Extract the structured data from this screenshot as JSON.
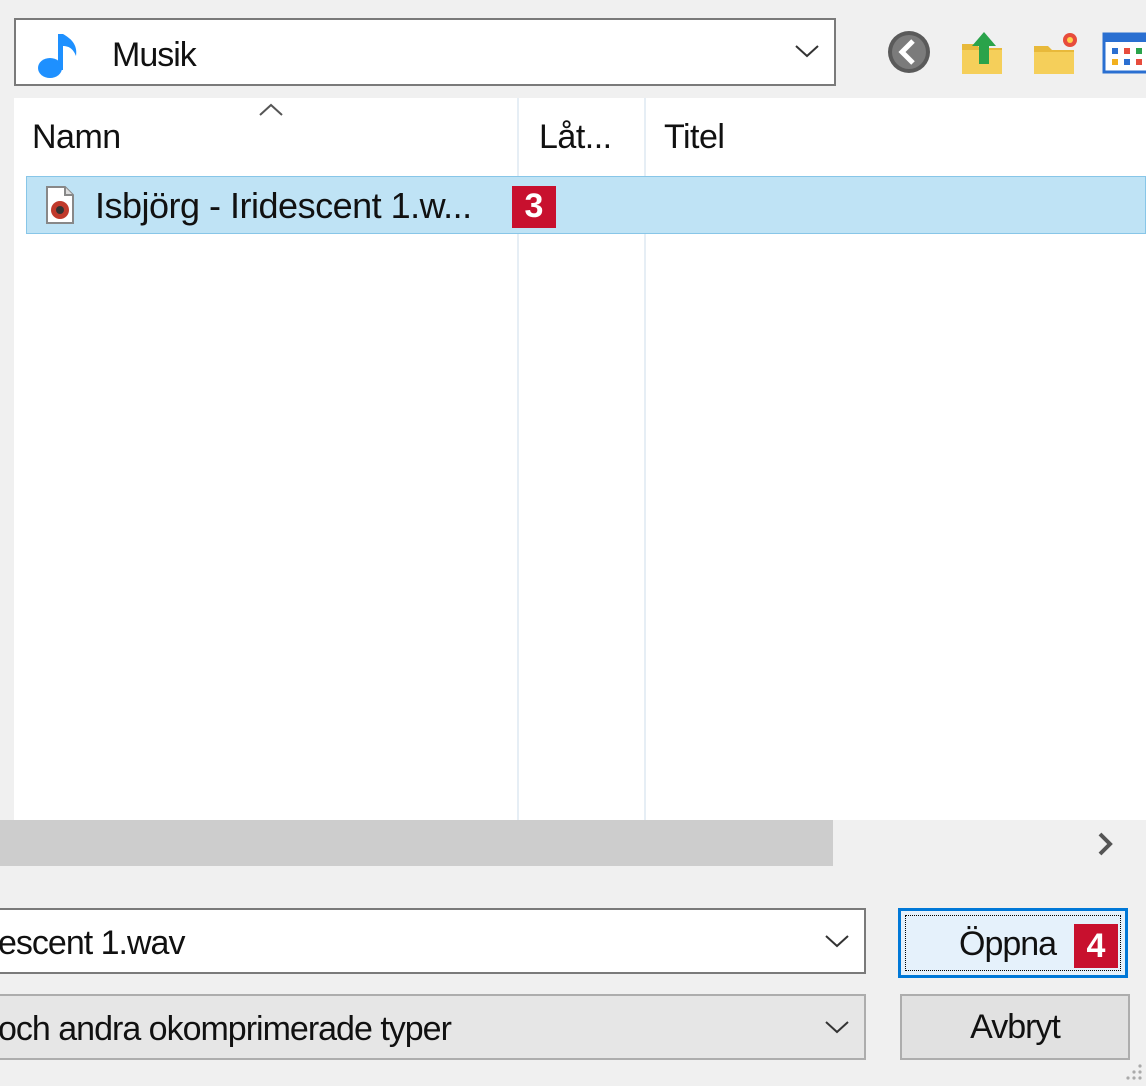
{
  "location": {
    "label": "Musik",
    "icon": "music-note-icon",
    "icon_color": "#1e90ff"
  },
  "toolbar": {
    "icons": [
      "back-icon",
      "up-folder-icon",
      "new-folder-icon",
      "view-menu-icon"
    ]
  },
  "columns": {
    "name": "Namn",
    "track": "Låt...",
    "title": "Titel"
  },
  "files": [
    {
      "name": "Isbjörg - Iridescent 1.w...",
      "icon": "audio-file-icon",
      "selected": true
    }
  ],
  "callouts": {
    "file": "3",
    "open": "4",
    "color": "#c8102e"
  },
  "filename_field": {
    "value": "escent 1.wav"
  },
  "file_type_filter": {
    "value": "och andra okomprimerade typer"
  },
  "buttons": {
    "open": "Öppna",
    "cancel": "Avbryt"
  },
  "colors": {
    "selection": "#bfe3f5",
    "focus": "#0078d7"
  }
}
